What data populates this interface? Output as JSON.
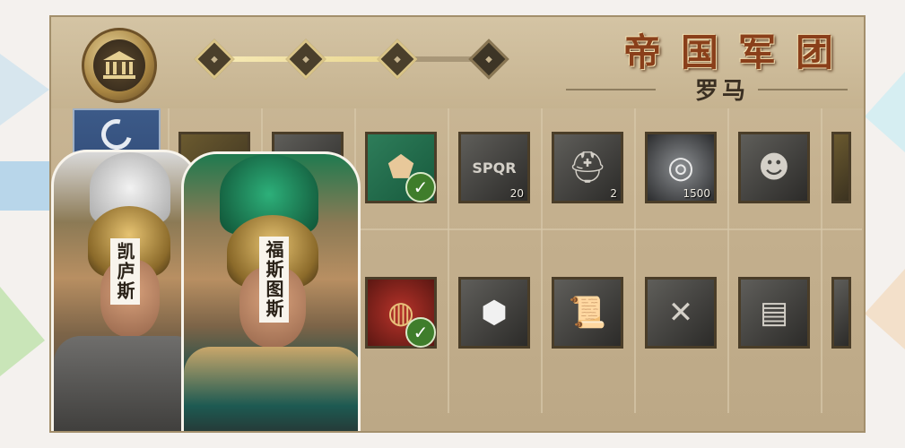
{
  "header": {
    "title": "帝国军团",
    "subtitle": "罗马"
  },
  "progress": {
    "nodes": 4,
    "filled_nodes": 3
  },
  "rewards_row1": [
    {
      "name": "gold-coin-pouch",
      "claimed": true,
      "count": ""
    },
    {
      "name": "sword-item",
      "claimed": false,
      "count": ""
    },
    {
      "name": "ore-chunk",
      "claimed": true,
      "count": ""
    },
    {
      "name": "spqr-eagle-standard",
      "claimed": false,
      "count": "20"
    },
    {
      "name": "spartan-helmet",
      "claimed": false,
      "count": "2"
    },
    {
      "name": "silver-coin",
      "claimed": false,
      "count": "1500"
    },
    {
      "name": "legionary-portrait",
      "claimed": false,
      "count": ""
    }
  ],
  "rewards_row2": [
    {
      "name": "red-shield",
      "claimed": true,
      "count": ""
    },
    {
      "name": "silver-gem",
      "claimed": false,
      "count": ""
    },
    {
      "name": "scroll-blueprint-1",
      "claimed": false,
      "count": ""
    },
    {
      "name": "scroll-blueprint-2",
      "claimed": false,
      "count": ""
    },
    {
      "name": "iron-ingot-stack",
      "claimed": false,
      "count": ""
    }
  ],
  "characters": [
    {
      "name": "凯庐斯"
    },
    {
      "name": "福斯图斯"
    }
  ],
  "colors": {
    "panel_bg": "#c5b18f",
    "title_red": "#8a3f1a",
    "check_green": "#3f7d2b"
  }
}
